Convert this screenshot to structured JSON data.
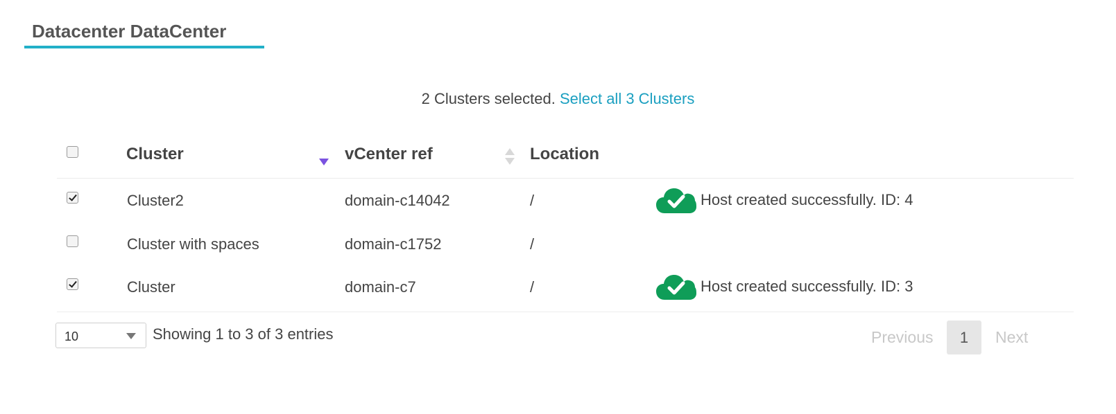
{
  "page": {
    "title": "Datacenter DataCenter"
  },
  "selection": {
    "text": "2 Clusters selected. ",
    "select_all_link": "Select all 3 Clusters"
  },
  "table": {
    "columns": [
      "Cluster",
      "vCenter ref",
      "Location"
    ],
    "sort": {
      "column": "Cluster",
      "direction": "desc"
    },
    "rows": [
      {
        "checked": true,
        "cluster": "Cluster2",
        "vcenter_ref": "domain-c14042",
        "location": "/",
        "status": "Host created successfully. ID: 4"
      },
      {
        "checked": false,
        "cluster": "Cluster with spaces",
        "vcenter_ref": "domain-c1752",
        "location": "/",
        "status": ""
      },
      {
        "checked": true,
        "cluster": "Cluster",
        "vcenter_ref": "domain-c7",
        "location": "/",
        "status": "Host created successfully. ID: 3"
      }
    ]
  },
  "footer": {
    "page_length": "10",
    "info": "Showing 1 to 3 of 3 entries",
    "previous": "Previous",
    "current_page": "1",
    "next": "Next"
  },
  "colors": {
    "accent": "#22b0c8",
    "link": "#1a9fc0",
    "success_cloud": "#0f9d58",
    "sort_active": "#7b52e0"
  },
  "icons": {
    "status": "cloud-check-icon"
  }
}
